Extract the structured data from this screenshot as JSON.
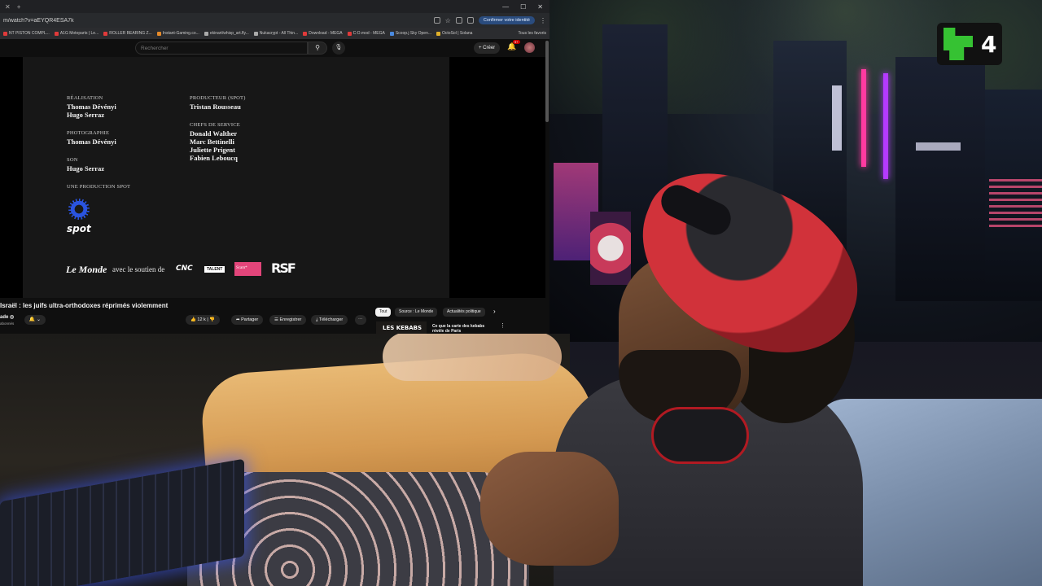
{
  "browser": {
    "url": "m/watch?v=aEYQR4ESA7k",
    "verify_label": "Confirmer votre identité",
    "bookmarks": [
      {
        "label": "NT PISTON COMPL...",
        "color": "#e03a3a"
      },
      {
        "label": "A1G Motoparts | Le...",
        "color": "#e03a3a"
      },
      {
        "label": "ROLLER BEARING Z...",
        "color": "#e03a3a"
      },
      {
        "label": "Instant-Gaming.co...",
        "color": "#e58a2a"
      },
      {
        "label": "ekinart/whisp_art.fly...",
        "color": "#aaaaaa"
      },
      {
        "label": "Nukacrypt - All Thin...",
        "color": "#aaaaaa"
      },
      {
        "label": "Download - MEGA",
        "color": "#e03a3a"
      },
      {
        "label": "C:O.mod - MEGA",
        "color": "#e03a3a"
      },
      {
        "label": "Scoop.j Sky Open...",
        "color": "#4a8ae0"
      },
      {
        "label": "OctoSol | Solana",
        "color": "#e0b02a"
      }
    ],
    "bookmarks_all": "Tous les favoris"
  },
  "youtube": {
    "search_placeholder": "Rechercher",
    "create_label": "Créer",
    "notif_count": "9+",
    "video_title": "Israël : les juifs ultra-orthodoxes réprimés violemment",
    "channel": "ade ◎",
    "subscribers": "abonnés",
    "likes": "12 k",
    "share": "Partager",
    "save": "Enregistrer",
    "download": "Télécharger",
    "more": "⋯",
    "chips": [
      "Tout",
      "Source : Le Monde",
      "Actualités politique"
    ],
    "rec_thumb_text": "LES KEBABS",
    "rec_title": "Ce que la carte des kebabs révèle de Paris"
  },
  "credits": {
    "realisation_label": "RÉALISATION",
    "realisation_names": [
      "Thomas Dévényi",
      "Hugo Serraz"
    ],
    "photo_label": "PHOTOGRAPHIE",
    "photo_names": [
      "Thomas Dévényi"
    ],
    "son_label": "SON",
    "son_names": [
      "Hugo Serraz"
    ],
    "prod_label": "UNE PRODUCTION SPOT",
    "spot_logo": "spot",
    "producteur_label": "PRODUCTEUR (SPOT)",
    "producteur_names": [
      "Tristan Rousseau"
    ],
    "chefs_label": "CHEFS DE SERVICE",
    "chefs_names": [
      "Donald Walther",
      "Marc Bettinelli",
      "Juliette Prigent",
      "Fabien Leboucq"
    ],
    "monde_logo": "Le Monde",
    "avec": "avec le soutien de",
    "cnc": "CNC",
    "talent": "TALENT",
    "scam": "Scam*",
    "rsf": "RSF"
  },
  "overlay": {
    "badge_number": "4",
    "badge_color": "#36c233"
  }
}
